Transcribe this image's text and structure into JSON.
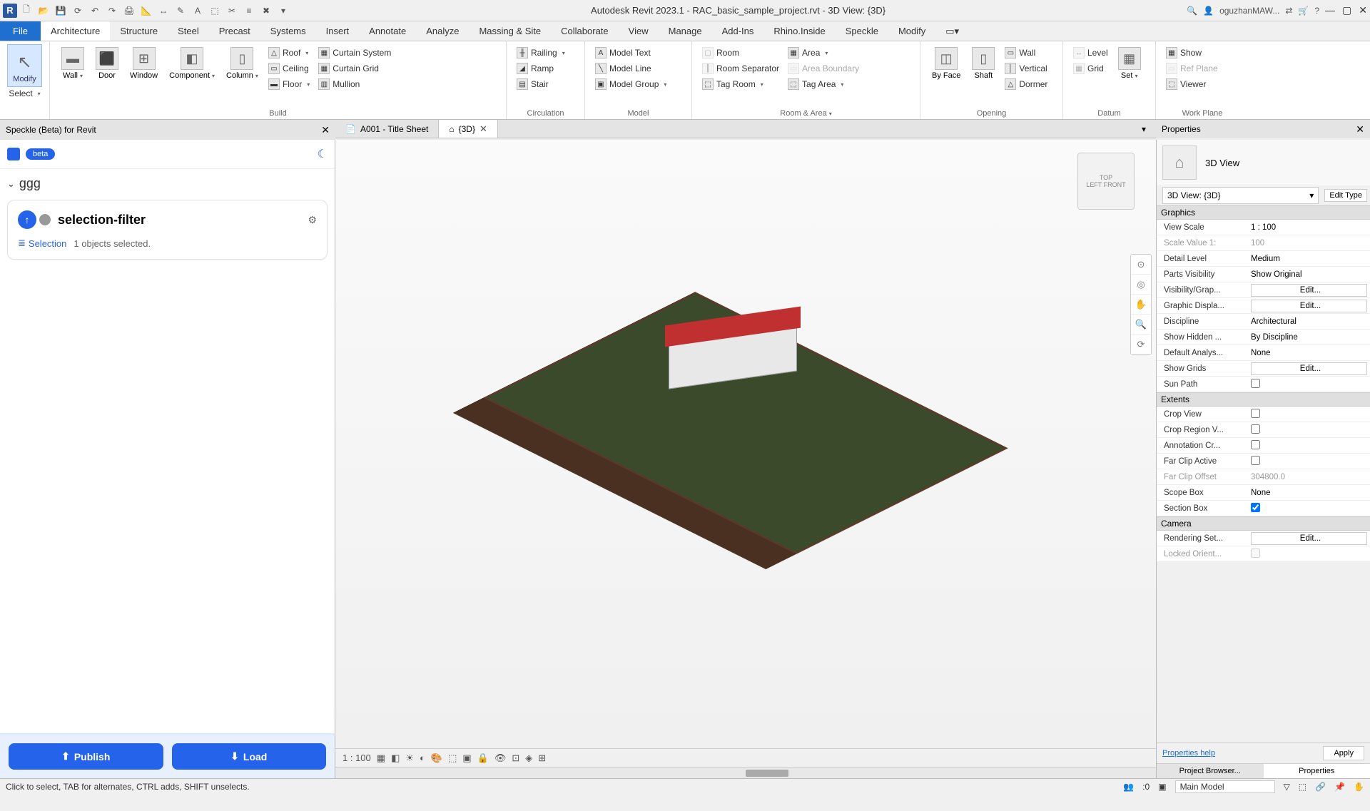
{
  "titlebar": {
    "app_letter": "R",
    "title": "Autodesk Revit 2023.1 - RAC_basic_sample_project.rvt - 3D View: {3D}",
    "user": "oguzhanMAW...",
    "help": "?"
  },
  "ribbon": {
    "file": "File",
    "tabs": [
      "Architecture",
      "Structure",
      "Steel",
      "Precast",
      "Systems",
      "Insert",
      "Annotate",
      "Analyze",
      "Massing & Site",
      "Collaborate",
      "View",
      "Manage",
      "Add-Ins",
      "Rhino.Inside",
      "Speckle",
      "Modify"
    ],
    "active_tab": "Architecture",
    "groups": {
      "select": {
        "modify": "Modify",
        "select": "Select",
        "label": ""
      },
      "build": {
        "label": "Build",
        "big": [
          "Wall",
          "Door",
          "Window",
          "Component",
          "Column"
        ],
        "col1": [
          "Roof",
          "Ceiling",
          "Floor"
        ],
        "col2": [
          "Curtain System",
          "Curtain Grid",
          "Mullion"
        ]
      },
      "circulation": {
        "label": "Circulation",
        "items": [
          "Railing",
          "Ramp",
          "Stair"
        ]
      },
      "model": {
        "label": "Model",
        "items": [
          "Model Text",
          "Model Line",
          "Model Group"
        ]
      },
      "roomarea": {
        "label": "Room & Area",
        "col1": [
          "Room",
          "Room Separator",
          "Tag Room"
        ],
        "col2": [
          "Area",
          "Area Boundary",
          "Tag Area"
        ]
      },
      "opening": {
        "label": "Opening",
        "big": [
          "By Face",
          "Shaft"
        ],
        "small": [
          "Wall",
          "Vertical",
          "Dormer"
        ]
      },
      "datum": {
        "label": "Datum",
        "items": [
          "Level",
          "Grid"
        ],
        "set": "Set"
      },
      "workplane": {
        "label": "Work Plane",
        "items": [
          "Show",
          "Ref Plane",
          "Viewer"
        ]
      }
    }
  },
  "doctabs": {
    "tab1": "A001 - Title Sheet",
    "tab2": "{3D}"
  },
  "speckle": {
    "header": "Speckle (Beta) for Revit",
    "beta": "beta",
    "project": "ggg",
    "card_title": "selection-filter",
    "selection_label": "Selection",
    "selection_count": "1 objects selected.",
    "publish": "Publish",
    "load": "Load"
  },
  "viewport": {
    "scale_display": "1 : 100",
    "navcube_front": "FRONT",
    "navcube_top": "TOP",
    "navcube_left": "LEFT"
  },
  "properties": {
    "header": "Properties",
    "type_name": "3D View",
    "view_combo": "3D View: {3D}",
    "edit_type": "Edit Type",
    "sections": {
      "graphics": "Graphics",
      "extents": "Extents",
      "camera": "Camera"
    },
    "rows": {
      "view_scale_k": "View Scale",
      "view_scale_v": "1 : 100",
      "scale_value_k": "Scale Value    1:",
      "scale_value_v": "100",
      "detail_level_k": "Detail Level",
      "detail_level_v": "Medium",
      "parts_vis_k": "Parts Visibility",
      "parts_vis_v": "Show Original",
      "vis_graph_k": "Visibility/Grap...",
      "edit_btn": "Edit...",
      "graphic_disp_k": "Graphic Displa...",
      "discipline_k": "Discipline",
      "discipline_v": "Architectural",
      "show_hidden_k": "Show Hidden ...",
      "show_hidden_v": "By Discipline",
      "default_analys_k": "Default Analys...",
      "default_analys_v": "None",
      "show_grids_k": "Show Grids",
      "sun_path_k": "Sun Path",
      "crop_view_k": "Crop View",
      "crop_region_k": "Crop Region V...",
      "anno_crop_k": "Annotation Cr...",
      "far_clip_active_k": "Far Clip Active",
      "far_clip_offset_k": "Far Clip Offset",
      "far_clip_offset_v": "304800.0",
      "scope_box_k": "Scope Box",
      "scope_box_v": "None",
      "section_box_k": "Section Box",
      "rendering_k": "Rendering Set...",
      "locked_orient_k": "Locked Orient..."
    },
    "help": "Properties help",
    "apply": "Apply",
    "panel_tab1": "Project Browser...",
    "panel_tab2": "Properties"
  },
  "statusbar": {
    "hint": "Click to select, TAB for alternates, CTRL adds, SHIFT unselects.",
    "zero": ":0",
    "model": "Main Model"
  }
}
